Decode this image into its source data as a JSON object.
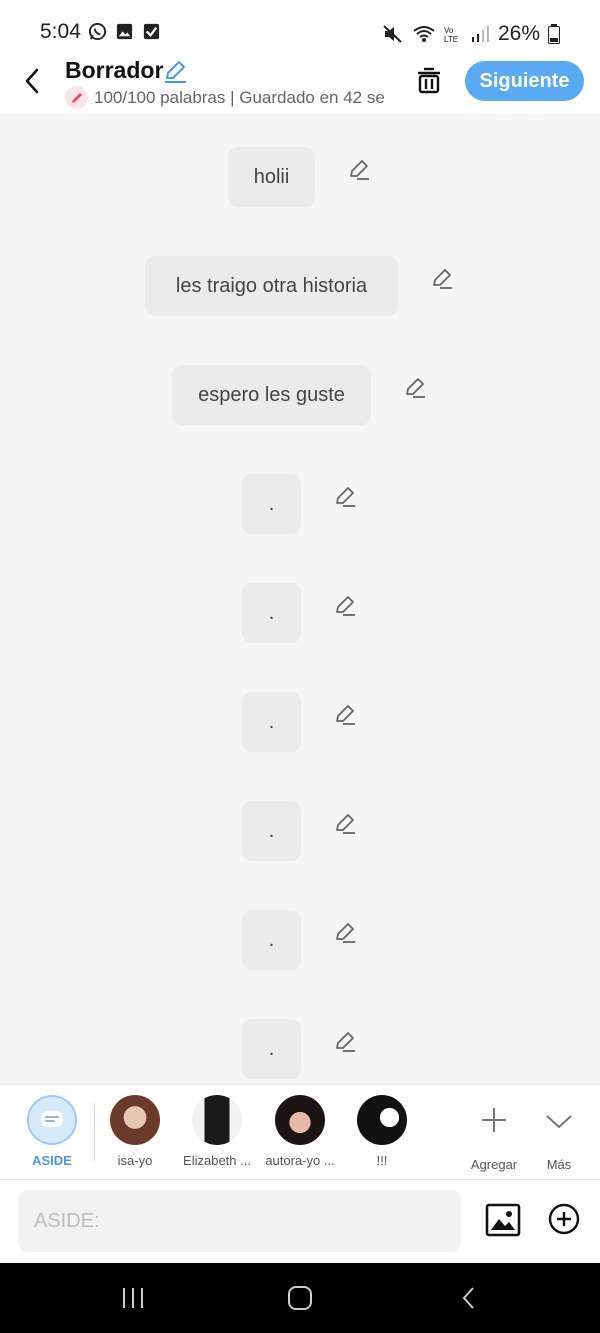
{
  "status_bar": {
    "time": "5:04",
    "battery": "26%"
  },
  "header": {
    "title": "Borrador",
    "subtitle": "100/100 palabras | Guardado en 42 se",
    "next_label": "Siguiente"
  },
  "messages": [
    {
      "text": "holii"
    },
    {
      "text": "les traigo otra historia"
    },
    {
      "text": "espero les guste"
    },
    {
      "text": "."
    },
    {
      "text": "."
    },
    {
      "text": "."
    },
    {
      "text": "."
    },
    {
      "text": "."
    },
    {
      "text": "."
    }
  ],
  "characters": [
    {
      "label": "ASIDE",
      "active": true
    },
    {
      "label": "isa-yo"
    },
    {
      "label": "Elizabeth ..."
    },
    {
      "label": "autora-yo ..."
    },
    {
      "label": "!!!"
    }
  ],
  "actions": {
    "add_label": "Agregar",
    "more_label": "Más"
  },
  "input": {
    "placeholder": "ASIDE:"
  },
  "colors": {
    "accent": "#5aa9f3",
    "bubble": "#ebebeb",
    "background": "#f5f5f5"
  }
}
